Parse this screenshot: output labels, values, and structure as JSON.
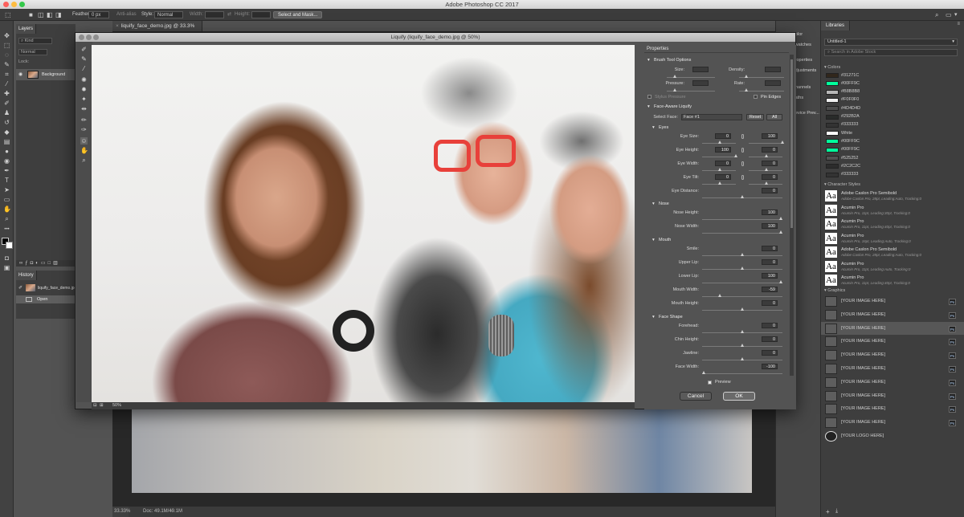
{
  "app": {
    "title": "Adobe Photoshop CC 2017"
  },
  "options_bar": {
    "feather_label": "Feather:",
    "feather_value": "0 px",
    "antialias_label": "Anti-alias",
    "style_label": "Style:",
    "style_value": "Normal",
    "width_label": "Width:",
    "height_label": "Height:",
    "select_mask_label": "Select and Mask..."
  },
  "document": {
    "tab_label": "liquify_face_demo.jpg @ 33.3% (RGB/8)",
    "zoom": "33.33%",
    "doc_info": "Doc: 49.1M/49.1M"
  },
  "layers_panel": {
    "tab": "Layers",
    "kind_label": "Kind",
    "blend_mode": "Normal",
    "lock_label": "Lock:",
    "layer_name": "Background"
  },
  "history_panel": {
    "tab": "History",
    "snapshot": "liquify_face_demo.jpg",
    "step": "Open"
  },
  "dock": {
    "items": [
      "Color",
      "Swatches",
      "Properties",
      "Adjustments",
      "Channels",
      "Paths",
      "Device Prev..."
    ]
  },
  "libraries": {
    "tab": "Libraries",
    "library_name": "Untitled-1",
    "search_placeholder": "Search in Adobe Stock",
    "colors_label": "Colors",
    "colors": [
      {
        "hex": "#31271C",
        "label": "#31271C"
      },
      {
        "hex": "#00FF9C",
        "label": "#00FF9C"
      },
      {
        "hex": "#B8B8B8",
        "label": "#B8B8B8"
      },
      {
        "hex": "#F0F0F0",
        "label": "#F0F0F0"
      },
      {
        "hex": "#4D4D4D",
        "label": "#4D4D4D"
      },
      {
        "hex": "#292B2A",
        "label": "#292B2A"
      },
      {
        "hex": "#333333",
        "label": "#333333"
      },
      {
        "hex": "#FFFFFF",
        "label": "White"
      },
      {
        "hex": "#00FF9C",
        "label": "#00FF9C"
      },
      {
        "hex": "#00FF9C",
        "label": "#00FF9C"
      },
      {
        "hex": "#525252",
        "label": "#525252"
      },
      {
        "hex": "#2C2C2C",
        "label": "#2C2C2C"
      },
      {
        "hex": "#333333",
        "label": "#333333"
      }
    ],
    "char_styles_label": "Character Styles",
    "char_styles": [
      {
        "name": "Adobe Caslon Pro Semibold",
        "desc": "Adobe Caslon Pro, 28pt, Leading:Auto, Tracking:0"
      },
      {
        "name": "Acumin Pro",
        "desc": "Acumin Pro, 11pt, Leading:30pt, Tracking:0"
      },
      {
        "name": "Acumin Pro",
        "desc": "Acumin Pro, 11pt, Leading:40pt, Tracking:0"
      },
      {
        "name": "Acumin Pro",
        "desc": "Acumin Pro, 16pt, Leading:Auto, Tracking:0"
      },
      {
        "name": "Adobe Caslon Pro Semibold",
        "desc": "Adobe Caslon Pro, 28pt, Leading:Auto, Tracking:0"
      },
      {
        "name": "Acumin Pro",
        "desc": "Acumin Pro, 11pt, Leading:Auto, Tracking:0"
      },
      {
        "name": "Acumin Pro",
        "desc": "Acumin Pro, 11pt, Leading:40pt, Tracking:0"
      }
    ],
    "graphics_label": "Graphics",
    "graphics": [
      "[YOUR IMAGE HERE]",
      "[YOUR IMAGE HERE]",
      "[YOUR IMAGE HERE]",
      "[YOUR IMAGE HERE]",
      "[YOUR IMAGE HERE]",
      "[YOUR IMAGE HERE]",
      "[YOUR IMAGE HERE]",
      "[YOUR IMAGE HERE]",
      "[YOUR IMAGE HERE]",
      "[YOUR IMAGE HERE]",
      "[YOUR LOGO HERE]"
    ],
    "badge": "Ps"
  },
  "liquify": {
    "title": "Liquify (liquify_face_demo.jpg @ 50%)",
    "zoom": "50%",
    "properties_label": "Properties",
    "brush_tool_options": "Brush Tool Options",
    "size_label": "Size:",
    "density_label": "Density:",
    "pressure_label": "Pressure:",
    "rate_label": "Rate:",
    "stylus_pressure": "Stylus Pressure",
    "pin_edges": "Pin Edges",
    "face_aware": "Face-Aware Liquify",
    "select_face_label": "Select Face:",
    "select_face_value": "Face #1",
    "reset": "Reset",
    "all": "All",
    "eyes": {
      "label": "Eyes",
      "rows": [
        {
          "label": "Eye Size:",
          "left": "0",
          "right": "100"
        },
        {
          "label": "Eye Height:",
          "left": "100",
          "right": "0"
        },
        {
          "label": "Eye Width:",
          "left": "0",
          "right": "0"
        },
        {
          "label": "Eye Tilt:",
          "left": "0",
          "right": "0"
        },
        {
          "label": "Eye Distance:",
          "value": "0"
        }
      ]
    },
    "nose": {
      "label": "Nose",
      "rows": [
        {
          "label": "Nose Height:",
          "value": "100"
        },
        {
          "label": "Nose Width:",
          "value": "100"
        }
      ]
    },
    "mouth": {
      "label": "Mouth",
      "rows": [
        {
          "label": "Smile:",
          "value": "0"
        },
        {
          "label": "Upper Lip:",
          "value": "0"
        },
        {
          "label": "Lower Lip:",
          "value": "100"
        },
        {
          "label": "Mouth Width:",
          "value": "-59"
        },
        {
          "label": "Mouth Height:",
          "value": "0"
        }
      ]
    },
    "face_shape": {
      "label": "Face Shape",
      "rows": [
        {
          "label": "Forehead:",
          "value": "0"
        },
        {
          "label": "Chin Height:",
          "value": "0"
        },
        {
          "label": "Jawline:",
          "value": "0"
        },
        {
          "label": "Face Width:",
          "value": "-100"
        }
      ]
    },
    "preview": "Preview",
    "cancel": "Cancel",
    "ok": "OK"
  }
}
